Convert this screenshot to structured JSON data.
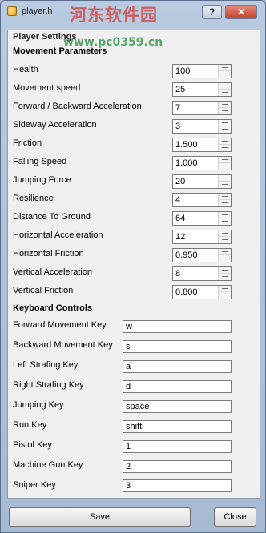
{
  "window": {
    "title": "player.h",
    "help_glyph": "?",
    "close_glyph": "✕",
    "watermark": "河东软件园",
    "watermark_url": "www.pc0359.cn"
  },
  "panel": {
    "title": "Player Settings"
  },
  "movement": {
    "heading": "Movement Parameters",
    "params": [
      {
        "label": "Health",
        "value": "100"
      },
      {
        "label": "Movement speed",
        "value": "25"
      },
      {
        "label": "Forward / Backward Acceleration",
        "value": "7"
      },
      {
        "label": "Sideway Acceleration",
        "value": "3"
      },
      {
        "label": "Friction",
        "value": "1.500"
      },
      {
        "label": "Falling Speed",
        "value": "1.000"
      },
      {
        "label": "Jumping Force",
        "value": "20"
      },
      {
        "label": "Resilience",
        "value": "4"
      },
      {
        "label": "Distance To Ground",
        "value": "64"
      },
      {
        "label": "Horizontal Acceleration",
        "value": "12"
      },
      {
        "label": "Horizontal Friction",
        "value": "0.950"
      },
      {
        "label": "Vertical Acceleration",
        "value": "8"
      },
      {
        "label": "Vertical Friction",
        "value": "0.800"
      }
    ]
  },
  "keyboard": {
    "heading": "Keyboard Controls",
    "keys": [
      {
        "label": "Forward Movement Key",
        "value": "w"
      },
      {
        "label": "Backward Movement Key",
        "value": "s"
      },
      {
        "label": "Left Strafing Key",
        "value": "a"
      },
      {
        "label": "Right Strafing Key",
        "value": "d"
      },
      {
        "label": "Jumping Key",
        "value": "space"
      },
      {
        "label": "Run Key",
        "value": "shiftl"
      },
      {
        "label": "Pistol Key",
        "value": "1"
      },
      {
        "label": "Machine Gun Key",
        "value": "2"
      },
      {
        "label": "Sniper Key",
        "value": "3"
      }
    ]
  },
  "buttons": {
    "save": "Save",
    "close": "Close"
  }
}
